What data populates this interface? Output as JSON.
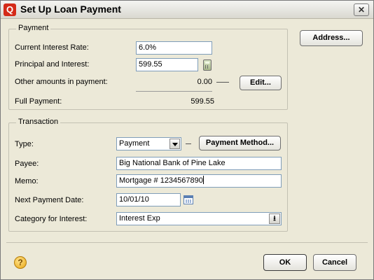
{
  "window": {
    "title": "Set Up Loan Payment",
    "app_icon_glyph": "Q",
    "close_glyph": "✕"
  },
  "payment_group": {
    "legend": "Payment",
    "current_interest_rate_label": "Current Interest Rate:",
    "current_interest_rate_value": "6.0%",
    "principal_interest_label": "Principal and Interest:",
    "principal_interest_value": "599.55",
    "other_amounts_label": "Other amounts in payment:",
    "other_amounts_value": "0.00",
    "edit_button": "Edit...",
    "full_payment_label": "Full Payment:",
    "full_payment_value": "599.55"
  },
  "transaction_group": {
    "legend": "Transaction",
    "type_label": "Type:",
    "type_value": "Payment",
    "payment_method_button": "Payment Method...",
    "payee_label": "Payee:",
    "payee_value": "Big National Bank of Pine Lake",
    "memo_label": "Memo:",
    "memo_value": "Mortgage # 1234567890",
    "next_payment_date_label": "Next Payment Date:",
    "next_payment_date_value": "10/01/10",
    "category_label": "Category for Interest:",
    "category_value": "Interest Exp"
  },
  "address_button": "Address...",
  "footer": {
    "help_glyph": "?",
    "ok_button": "OK",
    "cancel_button": "Cancel"
  },
  "icons": {
    "calculator": "calculator-icon",
    "calendar": "calendar-icon",
    "help": "help-icon",
    "dropdown": "chevron-down-icon",
    "category_list": "list-icon"
  }
}
